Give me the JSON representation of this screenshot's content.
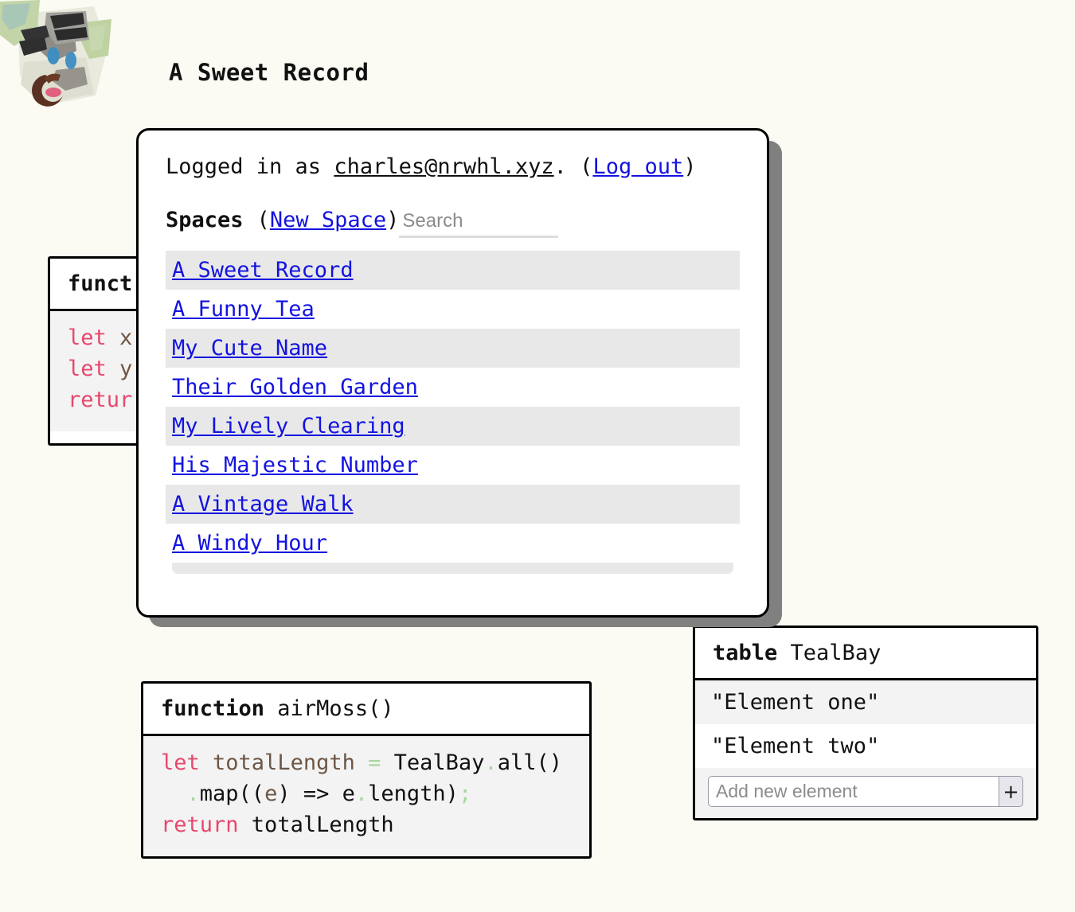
{
  "page": {
    "title": "A Sweet Record",
    "background_color": "#FBFAF3",
    "logo_name": "sheep-painting-logo"
  },
  "dialog": {
    "logged_in_prefix": "Logged in as ",
    "logged_in_email": "charles@nrwhl.xyz",
    "logged_in_suffix": ". (",
    "logout_label": "Log out",
    "logged_in_close": ")",
    "spaces_label": "Spaces",
    "paren_open": "(",
    "new_space_label": "New Space",
    "paren_close": ")",
    "search_placeholder": "Search",
    "search_value": "",
    "spaces": [
      {
        "label": "A Sweet Record",
        "shaded": true
      },
      {
        "label": "A Funny Tea",
        "shaded": false
      },
      {
        "label": "My Cute Name",
        "shaded": true
      },
      {
        "label": "Their Golden Garden",
        "shaded": false
      },
      {
        "label": "My Lively Clearing",
        "shaded": true
      },
      {
        "label": "His Majestic Number",
        "shaded": false
      },
      {
        "label": "A Vintage Walk",
        "shaded": true
      },
      {
        "label": "A Windy Hour",
        "shaded": false
      }
    ],
    "link_color": "#1313E0"
  },
  "left_card": {
    "header_keyword": "funct",
    "code_line_1_kw": "let",
    "code_line_1_var": " x",
    "code_line_2_kw": "let",
    "code_line_2_var": " y",
    "code_line_3_kw": "retur"
  },
  "airmoss_card": {
    "header_keyword": "function",
    "header_name": " airMoss()",
    "line1": {
      "kw": "let",
      "var": " totalLength ",
      "op": "=",
      "plain1": " TealBay",
      "dot": ".",
      "plain2": "all()"
    },
    "line2": {
      "indent": "  ",
      "dot": ".",
      "plain1": "map((",
      "var": "e",
      "plain2": ") => e",
      "dot2": ".",
      "plain3": "length)",
      "semi": ";"
    },
    "line3": {
      "kw": "return",
      "plain": " totalLength"
    }
  },
  "table_card": {
    "header_keyword": "table",
    "header_name": " TealBay",
    "rows": [
      {
        "value": "\"Element one\"",
        "alt": false
      },
      {
        "value": "\"Element two\"",
        "alt": true
      }
    ],
    "add_placeholder": "Add new element",
    "add_value": "",
    "add_button_label": "+"
  },
  "colors": {
    "keyword": "#E6486D",
    "variable": "#6E5645",
    "operator": "#A8D6A0",
    "shadow": "#808080",
    "row_shade": "#E8E8E8"
  }
}
